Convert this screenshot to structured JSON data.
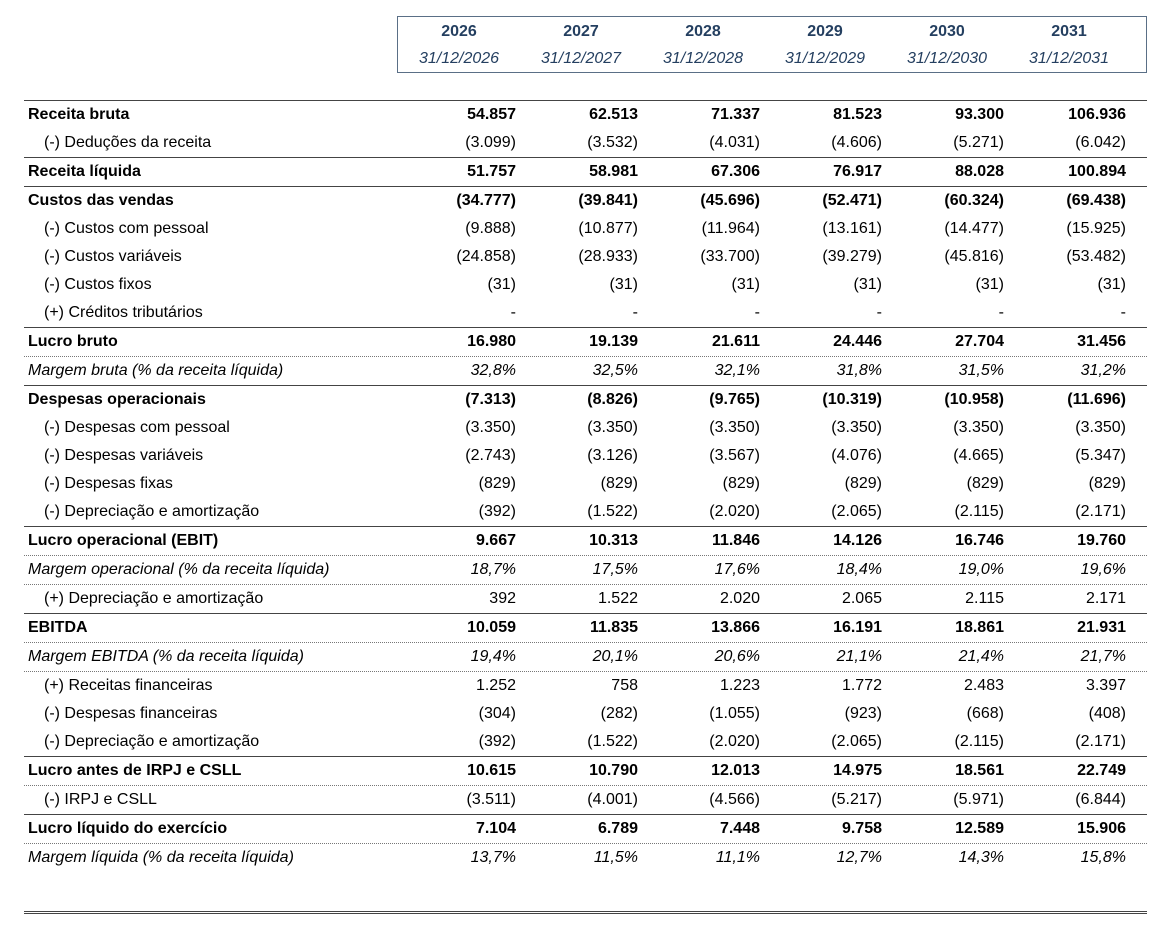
{
  "columns": [
    {
      "year": "2026",
      "date": "31/12/2026"
    },
    {
      "year": "2027",
      "date": "31/12/2027"
    },
    {
      "year": "2028",
      "date": "31/12/2028"
    },
    {
      "year": "2029",
      "date": "31/12/2029"
    },
    {
      "year": "2030",
      "date": "31/12/2030"
    },
    {
      "year": "2031",
      "date": "31/12/2031"
    }
  ],
  "rows": [
    {
      "label": "Receita bruta",
      "style": "bold",
      "values": [
        "54.857",
        "62.513",
        "71.337",
        "81.523",
        "93.300",
        "106.936"
      ]
    },
    {
      "label": "(-) Deduções da receita",
      "style": "indent",
      "values": [
        "(3.099)",
        "(3.532)",
        "(4.031)",
        "(4.606)",
        "(5.271)",
        "(6.042)"
      ]
    },
    {
      "label": "Receita líquida",
      "style": "bold",
      "values": [
        "51.757",
        "58.981",
        "67.306",
        "76.917",
        "88.028",
        "100.894"
      ]
    },
    {
      "label": "Custos das vendas",
      "style": "bold",
      "values": [
        "(34.777)",
        "(39.841)",
        "(45.696)",
        "(52.471)",
        "(60.324)",
        "(69.438)"
      ]
    },
    {
      "label": "(-) Custos com pessoal",
      "style": "indent",
      "values": [
        "(9.888)",
        "(10.877)",
        "(11.964)",
        "(13.161)",
        "(14.477)",
        "(15.925)"
      ]
    },
    {
      "label": "(-) Custos variáveis",
      "style": "indent",
      "values": [
        "(24.858)",
        "(28.933)",
        "(33.700)",
        "(39.279)",
        "(45.816)",
        "(53.482)"
      ]
    },
    {
      "label": "(-) Custos fixos",
      "style": "indent",
      "values": [
        "(31)",
        "(31)",
        "(31)",
        "(31)",
        "(31)",
        "(31)"
      ]
    },
    {
      "label": "(+) Créditos tributários",
      "style": "indent",
      "values": [
        "-",
        "-",
        "-",
        "-",
        "-",
        "-"
      ]
    },
    {
      "label": "Lucro bruto",
      "style": "bold",
      "values": [
        "16.980",
        "19.139",
        "21.611",
        "24.446",
        "27.704",
        "31.456"
      ]
    },
    {
      "label": "Margem bruta (% da receita líquida)",
      "style": "italic",
      "values": [
        "32,8%",
        "32,5%",
        "32,1%",
        "31,8%",
        "31,5%",
        "31,2%"
      ]
    },
    {
      "label": "Despesas operacionais",
      "style": "bold",
      "values": [
        "(7.313)",
        "(8.826)",
        "(9.765)",
        "(10.319)",
        "(10.958)",
        "(11.696)"
      ]
    },
    {
      "label": "(-) Despesas com pessoal",
      "style": "indent",
      "values": [
        "(3.350)",
        "(3.350)",
        "(3.350)",
        "(3.350)",
        "(3.350)",
        "(3.350)"
      ]
    },
    {
      "label": "(-) Despesas variáveis",
      "style": "indent",
      "values": [
        "(2.743)",
        "(3.126)",
        "(3.567)",
        "(4.076)",
        "(4.665)",
        "(5.347)"
      ]
    },
    {
      "label": "(-) Despesas fixas",
      "style": "indent",
      "values": [
        "(829)",
        "(829)",
        "(829)",
        "(829)",
        "(829)",
        "(829)"
      ]
    },
    {
      "label": "(-) Depreciação e amortização",
      "style": "indent",
      "values": [
        "(392)",
        "(1.522)",
        "(2.020)",
        "(2.065)",
        "(2.115)",
        "(2.171)"
      ]
    },
    {
      "label": "Lucro operacional (EBIT)",
      "style": "bold",
      "values": [
        "9.667",
        "10.313",
        "11.846",
        "14.126",
        "16.746",
        "19.760"
      ]
    },
    {
      "label": "Margem operacional (% da receita líquida)",
      "style": "italic",
      "values": [
        "18,7%",
        "17,5%",
        "17,6%",
        "18,4%",
        "19,0%",
        "19,6%"
      ]
    },
    {
      "label": "(+) Depreciação e amortização",
      "style": "indent",
      "values": [
        "392",
        "1.522",
        "2.020",
        "2.065",
        "2.115",
        "2.171"
      ]
    },
    {
      "label": "EBITDA",
      "style": "bold",
      "values": [
        "10.059",
        "11.835",
        "13.866",
        "16.191",
        "18.861",
        "21.931"
      ]
    },
    {
      "label": "Margem EBITDA (% da receita líquida)",
      "style": "italic",
      "values": [
        "19,4%",
        "20,1%",
        "20,6%",
        "21,1%",
        "21,4%",
        "21,7%"
      ]
    },
    {
      "label": "(+) Receitas financeiras",
      "style": "indent",
      "values": [
        "1.252",
        "758",
        "1.223",
        "1.772",
        "2.483",
        "3.397"
      ]
    },
    {
      "label": "(-) Despesas financeiras",
      "style": "indent",
      "values": [
        "(304)",
        "(282)",
        "(1.055)",
        "(923)",
        "(668)",
        "(408)"
      ]
    },
    {
      "label": "(-) Depreciação e amortização",
      "style": "indent",
      "values": [
        "(392)",
        "(1.522)",
        "(2.020)",
        "(2.065)",
        "(2.115)",
        "(2.171)"
      ]
    },
    {
      "label": "Lucro antes de IRPJ e CSLL",
      "style": "bold",
      "values": [
        "10.615",
        "10.790",
        "12.013",
        "14.975",
        "18.561",
        "22.749"
      ]
    },
    {
      "label": "(-) IRPJ e CSLL",
      "style": "indent",
      "values": [
        "(3.511)",
        "(4.001)",
        "(4.566)",
        "(5.217)",
        "(5.971)",
        "(6.844)"
      ]
    },
    {
      "label": "Lucro líquido do exercício",
      "style": "bold",
      "values": [
        "7.104",
        "6.789",
        "7.448",
        "9.758",
        "12.589",
        "15.906"
      ]
    },
    {
      "label": "Margem líquida (% da receita líquida)",
      "style": "italic",
      "values": [
        "13,7%",
        "11,5%",
        "11,1%",
        "12,7%",
        "14,3%",
        "15,8%"
      ]
    }
  ]
}
